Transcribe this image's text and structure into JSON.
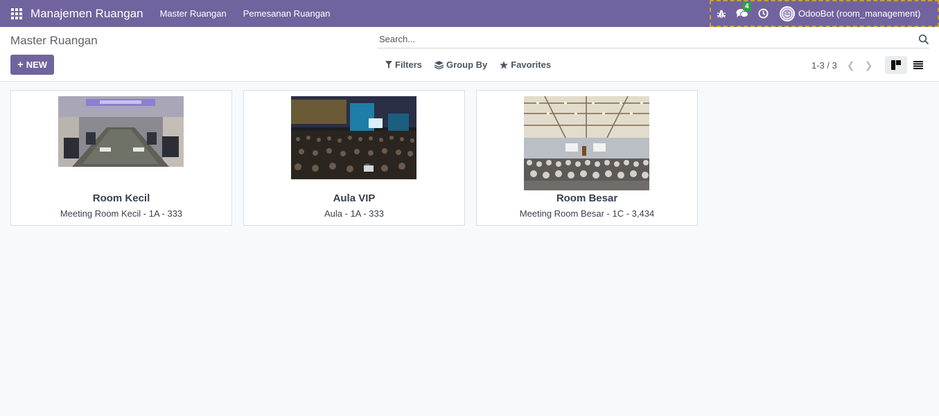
{
  "navbar": {
    "brand": "Manajemen Ruangan",
    "menu": [
      "Master Ruangan",
      "Pemesanan Ruangan"
    ],
    "messages_count": "4",
    "user_name": "OdooBot (room_management)"
  },
  "control": {
    "breadcrumb": "Master Ruangan",
    "new_label": "NEW",
    "search_placeholder": "Search...",
    "filters_label": "Filters",
    "groupby_label": "Group By",
    "favorites_label": "Favorites",
    "pager": "1-3 / 3"
  },
  "rooms": [
    {
      "name": "Room Kecil",
      "detail": "Meeting Room Kecil - 1A - 333",
      "image": "meeting-room-photo"
    },
    {
      "name": "Aula VIP",
      "detail": "Aula - 1A - 333",
      "image": "auditorium-photo"
    },
    {
      "name": "Room Besar",
      "detail": "Meeting Room Besar - 1C - 3,434",
      "image": "conference-hall-photo"
    }
  ],
  "colors": {
    "brand": "#71639e",
    "badge": "#28a745",
    "background": "#f8f9fb"
  }
}
